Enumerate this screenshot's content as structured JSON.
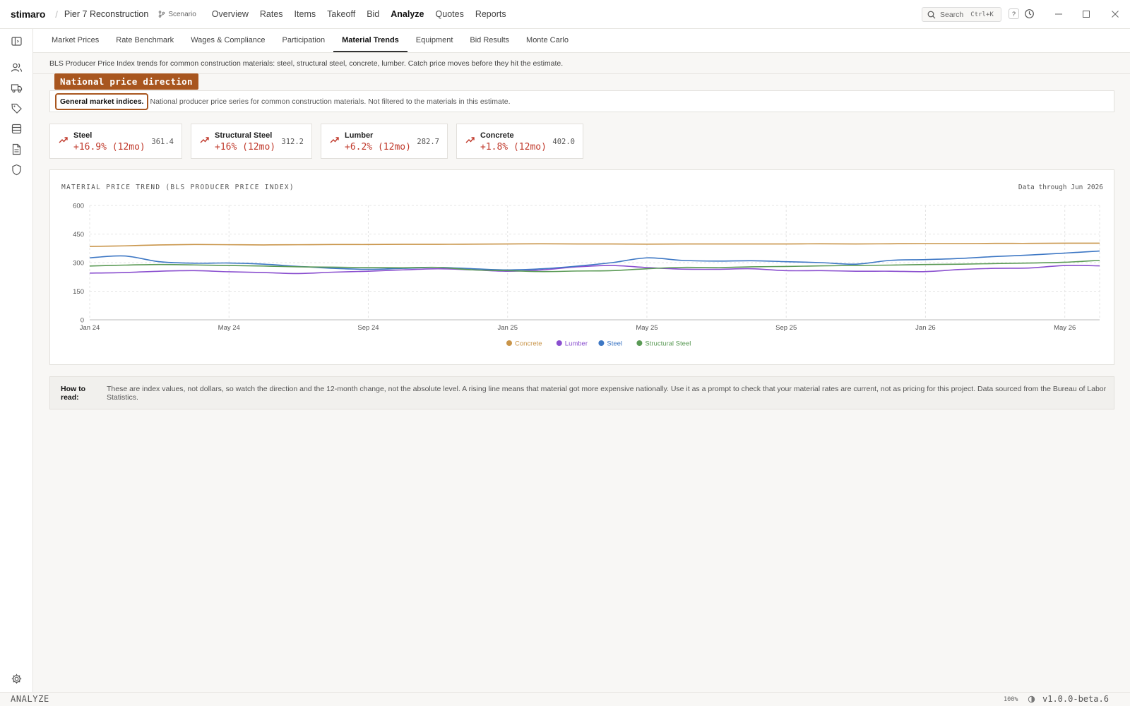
{
  "app": {
    "logo": "stimaro",
    "project": "Pier 7 Reconstruction",
    "scenario_label": "Scenario",
    "nav": [
      "Overview",
      "Rates",
      "Items",
      "Takeoff",
      "Bid",
      "Analyze",
      "Quotes",
      "Reports"
    ],
    "active_nav": "Analyze",
    "search_placeholder": "Search",
    "search_shortcut": "Ctrl+K",
    "help_label": "?"
  },
  "subtabs": [
    "Market Prices",
    "Rate Benchmark",
    "Wages & Compliance",
    "Participation",
    "Material Trends",
    "Equipment",
    "Bid Results",
    "Monte Carlo"
  ],
  "active_subtab": "Material Trends",
  "intro": "BLS Producer Price Index trends for common construction materials: steel, structural steel, concrete, lumber. Catch price moves before they hit the estimate.",
  "flag": "National price direction",
  "notice": {
    "strong": "General market indices.",
    "text": "National producer price series for common construction materials. Not filtered to the materials in this estimate."
  },
  "cards": [
    {
      "name": "Steel",
      "change": "+16.9% (12mo)",
      "value": "361.4"
    },
    {
      "name": "Structural Steel",
      "change": "+16% (12mo)",
      "value": "312.2"
    },
    {
      "name": "Lumber",
      "change": "+6.2% (12mo)",
      "value": "282.7"
    },
    {
      "name": "Concrete",
      "change": "+1.8% (12mo)",
      "value": "402.0"
    }
  ],
  "chart": {
    "title": "MATERIAL PRICE TREND (BLS PRODUCER PRICE INDEX)",
    "note": "Data through Jun 2026"
  },
  "colors": {
    "Concrete": "#c9954a",
    "Lumber": "#8a4fcf",
    "Steel": "#3d77c4",
    "Structural Steel": "#5a9a55",
    "accent": "#a8561f",
    "negative": "#c0392b"
  },
  "chart_data": {
    "type": "line",
    "xlabel": "",
    "ylabel": "",
    "ylim": [
      0,
      600
    ],
    "yticks": [
      0,
      150,
      300,
      450,
      600
    ],
    "x": [
      "Jan 24",
      "Feb 24",
      "Mar 24",
      "Apr 24",
      "May 24",
      "Jun 24",
      "Jul 24",
      "Aug 24",
      "Sep 24",
      "Oct 24",
      "Nov 24",
      "Dec 24",
      "Jan 25",
      "Feb 25",
      "Mar 25",
      "Apr 25",
      "May 25",
      "Jun 25",
      "Jul 25",
      "Aug 25",
      "Sep 25",
      "Oct 25",
      "Nov 25",
      "Dec 25",
      "Jan 26",
      "Feb 26",
      "Mar 26",
      "Apr 26",
      "May 26",
      "Jun 26"
    ],
    "x_tick_labels": [
      "Jan 24",
      "May 24",
      "Sep 24",
      "Jan 25",
      "May 25",
      "Sep 25",
      "Jan 26",
      "May 26"
    ],
    "legend": "bottom-center",
    "grid": true,
    "series": [
      {
        "name": "Concrete",
        "values": [
          385,
          388,
          393,
          395,
          394,
          393,
          394,
          395,
          395,
          396,
          396,
          397,
          398,
          399,
          398,
          398,
          397,
          398,
          398,
          398,
          398,
          399,
          398,
          399,
          400,
          400,
          401,
          401,
          402,
          402
        ]
      },
      {
        "name": "Lumber",
        "values": [
          245,
          248,
          255,
          258,
          252,
          248,
          243,
          250,
          255,
          262,
          268,
          262,
          255,
          262,
          278,
          285,
          274,
          266,
          265,
          268,
          258,
          258,
          255,
          255,
          253,
          264,
          270,
          272,
          285,
          283
        ]
      },
      {
        "name": "Steel",
        "values": [
          325,
          335,
          305,
          297,
          298,
          292,
          280,
          270,
          265,
          270,
          275,
          268,
          262,
          268,
          282,
          300,
          325,
          312,
          308,
          310,
          305,
          300,
          292,
          312,
          316,
          322,
          332,
          340,
          350,
          361
        ]
      },
      {
        "name": "Structural Steel",
        "values": [
          282,
          287,
          290,
          288,
          285,
          282,
          278,
          276,
          274,
          273,
          275,
          262,
          258,
          253,
          256,
          258,
          268,
          275,
          274,
          278,
          280,
          283,
          285,
          287,
          290,
          292,
          295,
          298,
          302,
          312
        ]
      }
    ]
  },
  "howto": {
    "label": "How to read:",
    "text": "These are index values, not dollars, so watch the direction and the 12-month change, not the absolute level. A rising line means that material got more expensive nationally. Use it as a prompt to check that your material rates are current, not as pricing for this project. Data sourced from the Bureau of Labor Statistics."
  },
  "status": {
    "mode": "ANALYZE",
    "zoom": "100%",
    "version": "v1.0.0-beta.6"
  },
  "icons": {
    "rail": [
      "sidebar-toggle-icon",
      "users-icon",
      "truck-icon",
      "tag-icon",
      "database-icon",
      "document-icon",
      "shield-icon",
      "gear-icon"
    ]
  }
}
